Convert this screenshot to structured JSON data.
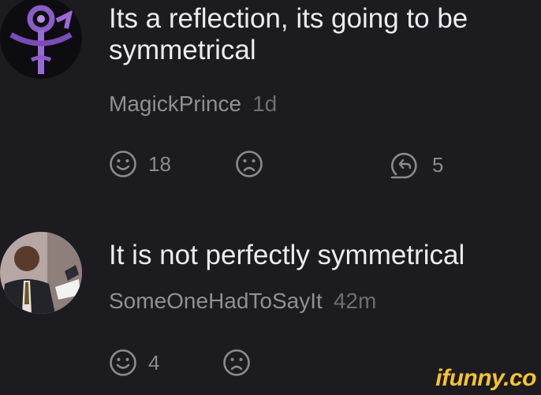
{
  "comments": [
    {
      "text": "Its a reflection, its going to be symmetrical",
      "username": "MagickPrince",
      "time": "1d",
      "likes": "18",
      "replies": "5"
    },
    {
      "text": "It is not perfectly symmetrical",
      "username": "SomeOneHadToSayIt",
      "time": "42m",
      "likes": "4"
    }
  ],
  "icons": {
    "like": "smile-icon",
    "dislike": "frown-icon",
    "reply": "reply-icon"
  },
  "colors": {
    "background": "#1c1b20",
    "text": "#ececec",
    "muted": "#8f8f94",
    "brand": "#f4c430",
    "accent_purple": "#8a5cc8"
  },
  "watermark": "ifunny.co"
}
